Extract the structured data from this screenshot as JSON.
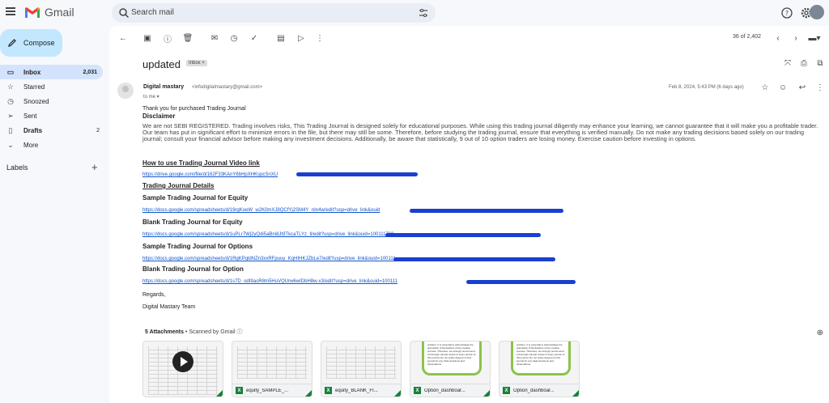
{
  "app": {
    "name": "Gmail"
  },
  "search": {
    "placeholder": "Search mail"
  },
  "compose": {
    "label": "Compose"
  },
  "nav": [
    {
      "label": "Inbox",
      "count": "2,031",
      "icon": "inbox-icon",
      "active": true,
      "bold": true
    },
    {
      "label": "Starred",
      "count": "",
      "icon": "star-icon"
    },
    {
      "label": "Snoozed",
      "count": "",
      "icon": "clock-icon"
    },
    {
      "label": "Sent",
      "count": "",
      "icon": "send-icon"
    },
    {
      "label": "Drafts",
      "count": "2",
      "icon": "draft-icon",
      "bold": true
    },
    {
      "label": "More",
      "count": "",
      "icon": "chevron-down-icon"
    }
  ],
  "labels": {
    "heading": "Labels",
    "add": "+"
  },
  "pager": {
    "text": "36 of 2,402"
  },
  "message": {
    "subject": "updated",
    "badge": "Inbox ×",
    "sender_name": "Digital mastary",
    "sender_email": "<infodigitalmastary@gmail.com>",
    "to": "to me ▾",
    "date": "Feb 8, 2024, 5:43 PM (6 days ago)",
    "greeting": "Thank you for purchased Trading Journal",
    "disclaimer_heading": "Disclaimer",
    "disclaimer_text": "We are not SEBI REGISTERED. Trading involves risks, This Trading Journal is designed solely for educational purposes. While using this trading journal diligently may enhance your learning, we cannot guarantee that it will make you a profitable trader. Our team has put in significant effort to minimize errors in the file, but there may still be some. Therefore, before studying the trading journal, ensure that everything is verified manually. Do not make any trading decisions based solely on our trading journal; consult your financial advisor before making any investment decisions. Additionally, be aware that statistically, 9 out of 10 option traders are losing money. Exercise caution before investing in options.",
    "video_heading": "How to use Trading Journal Video link",
    "video_link": "https://drive.google.com/file/d/162F33KAnY6bHpXHKspcSnXU",
    "details_heading": "Trading Journal Details",
    "sections": [
      {
        "title": "Sample Trading Journal for Equity",
        "link": "https://docs.google.com/spreadsheets/d/19rgKoeW_w2K0mXJ8QCfYj2SM4Y_nIn4w/edit?usp=drive_link&ouid"
      },
      {
        "title": "Blank Trading Journal for Equity",
        "link": "https://docs.google.com/spreadsheets/d/1uPLr7Wj2yQdi5aBni8Jt9TkcaTLYz_Il/edit?usp=drive_link&ouid=100111769"
      },
      {
        "title": "Sample Trading Journal for Options",
        "link": "https://docs.google.com/spreadsheets/d/1RgKPqldNZn3xxRFpuuy_KqHIHKJZbLe7/edit?usp=drive_link&ouid=100111"
      },
      {
        "title": "Blank Trading Journal for Option",
        "link": "https://docs.google.com/spreadsheets/d/1s7D_odI9aoR8m5HuVQUrw6wIDbH8w-x3/edit?usp=drive_link&ouid=100111"
      }
    ],
    "sign_1": "Regards,",
    "sign_2": "Digital Mastary Team"
  },
  "attachments": {
    "heading_count": "5 Attachments",
    "heading_scan": " • Scanned by Gmail ⓘ",
    "items": [
      {
        "name": "",
        "kind": "video"
      },
      {
        "name": "equity_SAMPLE_...",
        "kind": "sheet"
      },
      {
        "name": "equity_BLANK_FI...",
        "kind": "sheet"
      },
      {
        "name": "Option_dashboar...",
        "kind": "doc"
      },
      {
        "name": "Option_dashboar...",
        "kind": "doc"
      }
    ],
    "doc_preview_text": "problem. It is essential to acknowledge the granularity of fluctuations of the creative process. Therefore, we strongly recommend a thorough manual review of every portion of this journal. Do not solely depend on this journal for any trade decisions and observations."
  },
  "colors": {
    "accent": "#c2e7ff",
    "active_nav": "#d3e3fd",
    "link": "#1155cc",
    "redaction": "#1a3fd1"
  }
}
